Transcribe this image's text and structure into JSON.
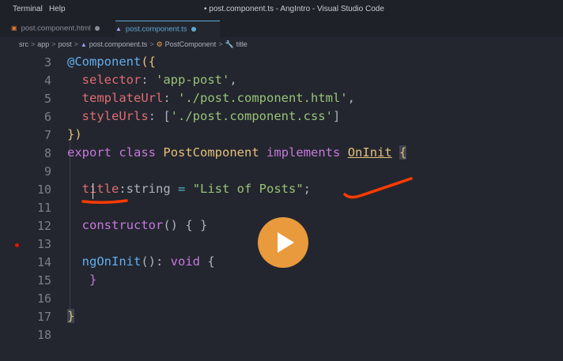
{
  "menu": {
    "terminal": "Terminal",
    "help": "Help"
  },
  "window_title": "• post.component.ts - AngIntro - Visual Studio Code",
  "tabs": [
    {
      "label": "post.component.html",
      "icon": "html-file-icon",
      "active": false
    },
    {
      "label": "post.component.ts",
      "icon": "angular-icon",
      "active": true
    }
  ],
  "breadcrumb": {
    "parts": [
      "src",
      "app",
      "post",
      "post.component.ts",
      "PostComponent",
      "title"
    ],
    "separator": ">"
  },
  "line_numbers": [
    "3",
    "4",
    "5",
    "6",
    "7",
    "8",
    "9",
    "10",
    "11",
    "12",
    "13",
    "14",
    "15",
    "16",
    "17",
    "18"
  ],
  "code": {
    "l3_a": "@Component",
    "l3_b": "({",
    "l4_a": "selector",
    "l4_b": ": ",
    "l4_c": "'app-post'",
    "l4_d": ",",
    "l5_a": "templateUrl",
    "l5_b": ": ",
    "l5_c": "'./post.component.html'",
    "l5_d": ",",
    "l6_a": "styleUrls",
    "l6_b": ": [",
    "l6_c": "'./post.component.css'",
    "l6_d": "]",
    "l7": "})",
    "l8_a": "export",
    "l8_b": "class",
    "l8_c": "PostComponent",
    "l8_d": "implements",
    "l8_e": "OnInit",
    "l8_f": "{",
    "l10_a": "title",
    "l10_b": ":string ",
    "l10_c": "=",
    "l10_d": "\"List of Posts\"",
    "l10_e": ";",
    "l12_a": "constructor",
    "l12_b": "() { }",
    "l14_a": "ngOnInit",
    "l14_b": "(): ",
    "l14_c": "void",
    "l14_d": " {",
    "l15": "}",
    "l17": "}"
  },
  "colors": {
    "background": "#23262e",
    "keyword": "#c678dd",
    "function": "#61afef",
    "property": "#e06c75",
    "string": "#98c379",
    "class": "#e5c07b",
    "annotation_ink": "#ff3b00",
    "play_button": "#e89a3c"
  },
  "play_button": {
    "icon": "play-icon"
  }
}
